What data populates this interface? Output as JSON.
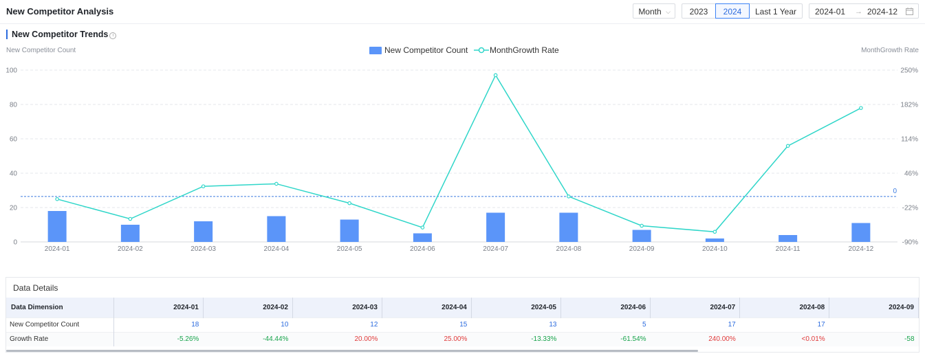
{
  "header": {
    "title": "New Competitor Analysis",
    "period_select": "Month",
    "year_buttons": [
      "2023",
      "2024",
      "Last 1 Year"
    ],
    "active_year": "2024",
    "date_start": "2024-01",
    "date_sep": "→",
    "date_end": "2024-12"
  },
  "section": {
    "title": "New Competitor Trends",
    "info_icon": "ⓘ"
  },
  "chart_data": {
    "type": "bar",
    "categories": [
      "2024-01",
      "2024-02",
      "2024-03",
      "2024-04",
      "2024-05",
      "2024-06",
      "2024-07",
      "2024-08",
      "2024-09",
      "2024-10",
      "2024-11",
      "2024-12"
    ],
    "series": [
      {
        "name": "New Competitor Count",
        "type": "bar",
        "axis": "left",
        "color": "#5b95f9",
        "values": [
          18,
          10,
          12,
          15,
          13,
          5,
          17,
          17,
          7,
          2,
          4,
          11
        ]
      },
      {
        "name": "MonthGrowth Rate",
        "type": "line",
        "axis": "right",
        "color": "#2fd6c9",
        "values": [
          -5.26,
          -44.44,
          20.0,
          25.0,
          -13.33,
          -61.54,
          240.0,
          0,
          -58,
          -70,
          100,
          175
        ]
      }
    ],
    "ylabel_left": "New Competitor Count",
    "ylabel_right": "MonthGrowth Rate",
    "left_ticks": [
      "100",
      "80",
      "60",
      "40",
      "20",
      "0"
    ],
    "right_ticks": [
      "250%",
      "182%",
      "114%",
      "46%",
      "-22%",
      "-90%"
    ],
    "ylim_left": [
      0,
      100
    ],
    "ylim_right": [
      -90,
      250
    ],
    "reference_line": {
      "label": "0",
      "value": 0
    },
    "grid": true,
    "legend": "top-center"
  },
  "details": {
    "title": "Data Details",
    "dimension_header": "Data Dimension",
    "columns": [
      "2024-01",
      "2024-02",
      "2024-03",
      "2024-04",
      "2024-05",
      "2024-06",
      "2024-07",
      "2024-08",
      "2024-09"
    ],
    "rows": [
      {
        "label": "New Competitor Count",
        "cells": [
          "18",
          "10",
          "12",
          "15",
          "13",
          "5",
          "17",
          "17",
          ""
        ],
        "style": "num"
      },
      {
        "label": "Growth Rate",
        "cells": [
          "-5.26%",
          "-44.44%",
          "20.00%",
          "25.00%",
          "-13.33%",
          "-61.54%",
          "240.00%",
          "<0.01%",
          "-58"
        ],
        "style": "rate"
      }
    ]
  }
}
